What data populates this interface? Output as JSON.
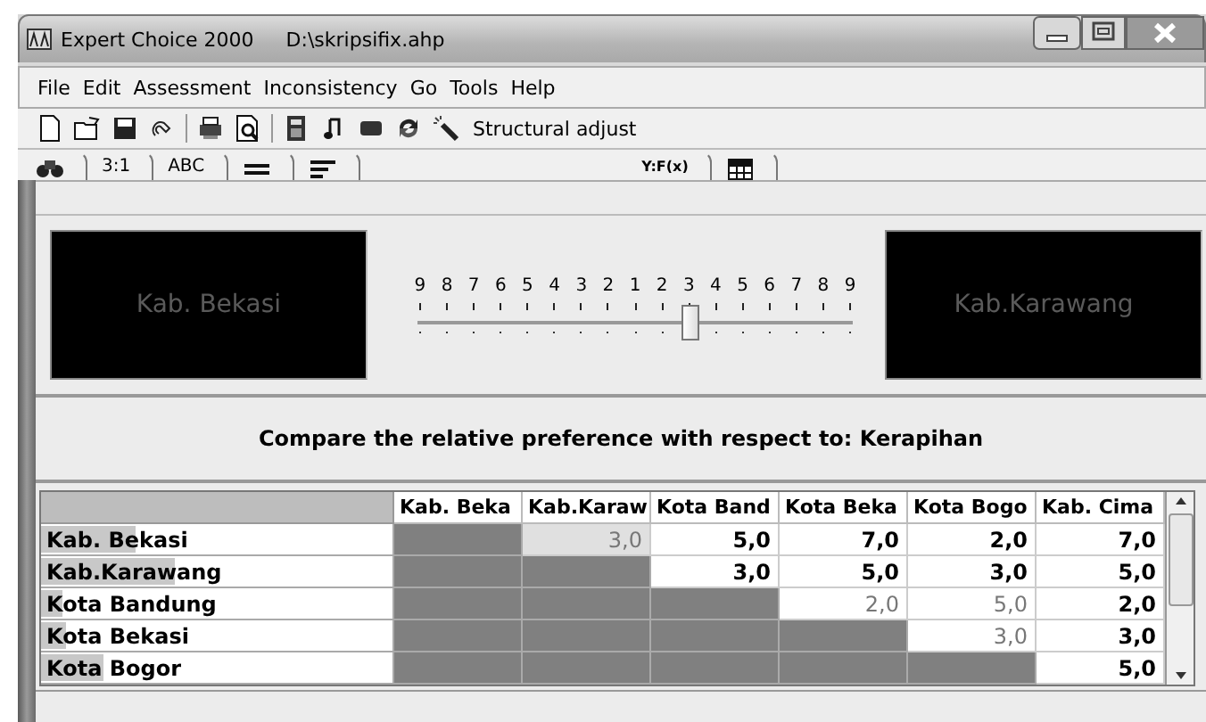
{
  "window": {
    "title": "Expert Choice 2000",
    "file": "D:\\skripsifix.ahp"
  },
  "menu": [
    "File",
    "Edit",
    "Assessment",
    "Inconsistency",
    "Go",
    "Tools",
    "Help"
  ],
  "toolbar": {
    "label": "Structural adjust"
  },
  "tabs": [
    {
      "kind": "icon"
    },
    {
      "kind": "text",
      "label": "3:1"
    },
    {
      "kind": "text",
      "label": "ABC"
    },
    {
      "kind": "icon"
    },
    {
      "kind": "icon"
    },
    {
      "kind": "spacer"
    },
    {
      "kind": "text",
      "label": "Y:F(x)"
    },
    {
      "kind": "icon"
    }
  ],
  "comparison": {
    "left": "Kab. Bekasi",
    "right": "Kab.Karawang",
    "scale": [
      "9",
      "8",
      "7",
      "6",
      "5",
      "4",
      "3",
      "2",
      "1",
      "2",
      "3",
      "4",
      "5",
      "6",
      "7",
      "8",
      "9"
    ],
    "level": 0.625,
    "prompt": "Compare the relative preference  with respect to: Kerapihan"
  },
  "grid": {
    "columns": [
      "Kab. Beka",
      "Kab.Karaw",
      "Kota Band",
      "Kota Beka",
      "Kota Bogo",
      "Kab. Cima"
    ],
    "rows": [
      {
        "name": "Kab. Bekasi",
        "level": 0.27,
        "cells": [
          {
            "kind": "blank"
          },
          {
            "kind": "value",
            "text": "3,0",
            "dim": true,
            "selected": true
          },
          {
            "kind": "value",
            "text": "5,0",
            "dim": false,
            "selected": false
          },
          {
            "kind": "value",
            "text": "7,0",
            "dim": false,
            "selected": false
          },
          {
            "kind": "value",
            "text": "2,0",
            "dim": false,
            "selected": false
          },
          {
            "kind": "value",
            "text": "7,0",
            "dim": false,
            "selected": false
          }
        ]
      },
      {
        "name": "Kab.Karawang",
        "level": 0.38,
        "cells": [
          {
            "kind": "blank"
          },
          {
            "kind": "blank"
          },
          {
            "kind": "value",
            "text": "3,0",
            "dim": false,
            "selected": false
          },
          {
            "kind": "value",
            "text": "5,0",
            "dim": false,
            "selected": false
          },
          {
            "kind": "value",
            "text": "3,0",
            "dim": false,
            "selected": false
          },
          {
            "kind": "value",
            "text": "5,0",
            "dim": false,
            "selected": false
          }
        ]
      },
      {
        "name": "Kota Bandung",
        "level": 0.06,
        "cells": [
          {
            "kind": "blank"
          },
          {
            "kind": "blank"
          },
          {
            "kind": "blank"
          },
          {
            "kind": "value",
            "text": "2,0",
            "dim": true,
            "selected": false
          },
          {
            "kind": "value",
            "text": "5,0",
            "dim": true,
            "selected": false
          },
          {
            "kind": "value",
            "text": "2,0",
            "dim": false,
            "selected": false
          }
        ]
      },
      {
        "name": "Kota Bekasi",
        "level": 0.07,
        "cells": [
          {
            "kind": "blank"
          },
          {
            "kind": "blank"
          },
          {
            "kind": "blank"
          },
          {
            "kind": "blank"
          },
          {
            "kind": "value",
            "text": "3,0",
            "dim": true,
            "selected": false
          },
          {
            "kind": "value",
            "text": "3,0",
            "dim": false,
            "selected": false
          }
        ]
      },
      {
        "name": "Kota Bogor",
        "level": 0.18,
        "cells": [
          {
            "kind": "blank"
          },
          {
            "kind": "blank"
          },
          {
            "kind": "blank"
          },
          {
            "kind": "blank"
          },
          {
            "kind": "blank"
          },
          {
            "kind": "value",
            "text": "5,0",
            "dim": false,
            "selected": false
          }
        ]
      }
    ]
  }
}
